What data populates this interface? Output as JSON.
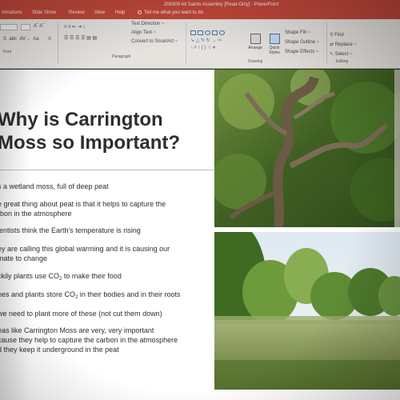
{
  "window": {
    "title": "200309 All Saints Assembly [Read-Only] - PowerPoint"
  },
  "tabs": [
    {
      "label": "nimations"
    },
    {
      "label": "Slide Show"
    },
    {
      "label": "Review"
    },
    {
      "label": "View"
    },
    {
      "label": "Help"
    }
  ],
  "tell_me": {
    "placeholder": "Tell me what you want to do"
  },
  "ribbon": {
    "groups": {
      "font_label": "Font",
      "paragraph_label": "Paragraph",
      "drawing_label": "Drawing",
      "editing_label": "Editing"
    },
    "paragraph": {
      "text_direction": "Text Direction ~",
      "align_text": "Align Text ~",
      "convert_smartart": "Convert to SmartArt ~"
    },
    "drawing": {
      "arrange": "Arrange",
      "quick_styles": "Quick Styles",
      "shape_fill": "Shape Fill ~",
      "shape_outline": "Shape Outline ~",
      "shape_effects": "Shape Effects ~"
    },
    "editing": {
      "find": "Find",
      "replace": "Replace ~",
      "select": "Select ~"
    }
  },
  "slide": {
    "title_line1": "Why is Carrington",
    "title_line2": "Moss so Important?",
    "bullets": [
      {
        "line1": "s a wetland moss, full of deep peat"
      },
      {
        "line1": "e great thing about peat is that it helps to capture the",
        "line2": "rbon in the atmosphere"
      },
      {
        "line1": "ientists think the Earth's temperature is rising"
      },
      {
        "line1": "ey are calling this global warming and it is causing our",
        "line2": "mate to change"
      },
      {
        "line1_pre": "ckily plants use CO",
        "line1_sub": "2",
        "line1_post": " to make their food"
      },
      {
        "line1_pre": "ees and plants store CO",
        "line1_sub": "2",
        "line1_post": " in their bodies and in their roots"
      },
      {
        "line1": " we need to plant more of these (not cut them down)"
      },
      {
        "line1": "eas like Carrington Moss are very, very important",
        "line2": "cause they help to capture the carbon in the atmosphere",
        "line3": "d they keep it underground in the peat"
      }
    ]
  },
  "colors": {
    "title_bar": "#c0473a",
    "ribbon": "#e6e3df",
    "slide_bg": "#ffffff",
    "text": "#2f2f2f"
  }
}
